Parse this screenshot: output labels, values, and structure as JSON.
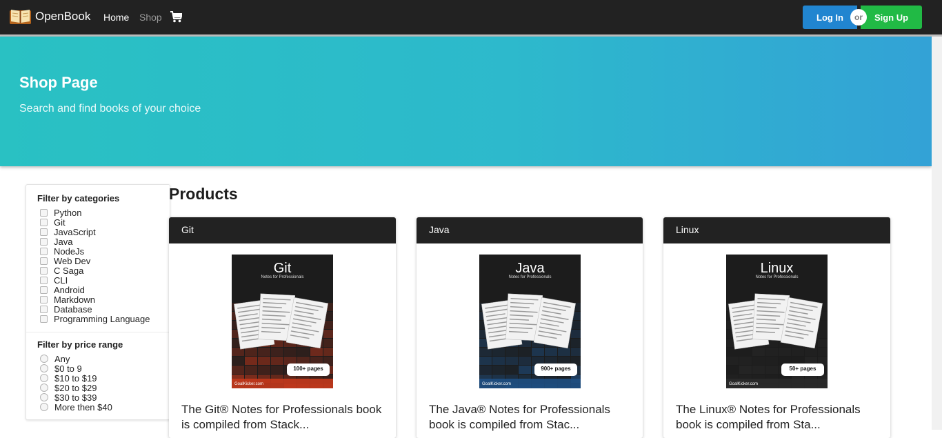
{
  "navbar": {
    "brand": "OpenBook",
    "links": [
      "Home",
      "Shop"
    ],
    "login_label": "Log In",
    "or_label": "or",
    "signup_label": "Sign Up"
  },
  "hero": {
    "title": "Shop Page",
    "subtitle": "Search and find books of your choice"
  },
  "sidebar": {
    "categories_title": "Filter by categories",
    "categories": [
      "Python",
      "Git",
      "JavaScript",
      "Java",
      "NodeJs",
      "Web Dev",
      "C Saga",
      "CLI",
      "Android",
      "Markdown",
      "Database",
      "Programming Language"
    ],
    "price_title": "Filter by price range",
    "prices": [
      "Any",
      "$0 to 9",
      "$10 to $19",
      "$20 to $29",
      "$30 to $39",
      "More then $40"
    ]
  },
  "products": {
    "title": "Products",
    "items": [
      {
        "name": "Git",
        "cover_title": "Git",
        "cover_sub": "Notes for Professionals",
        "pages": "100+ pages",
        "site": "GoalKicker.com",
        "desc": "The Git® Notes for Professionals book is compiled from Stack...",
        "color": "#c2381c"
      },
      {
        "name": "Java",
        "cover_title": "Java",
        "cover_sub": "Notes for Professionals",
        "pages": "900+ pages",
        "site": "GoalKicker.com",
        "desc": "The Java® Notes for Professionals book is compiled from Stac...",
        "color": "#1f4f82"
      },
      {
        "name": "Linux",
        "cover_title": "Linux",
        "cover_sub": "Notes for Professionals",
        "pages": "50+ pages",
        "site": "GoalKicker.com",
        "desc": "The Linux® Notes for Professionals book is compiled from Sta...",
        "color": "#2a2a2a"
      }
    ]
  },
  "icons": {
    "brand": "open-book-icon",
    "cart": "shopping-cart-icon"
  }
}
